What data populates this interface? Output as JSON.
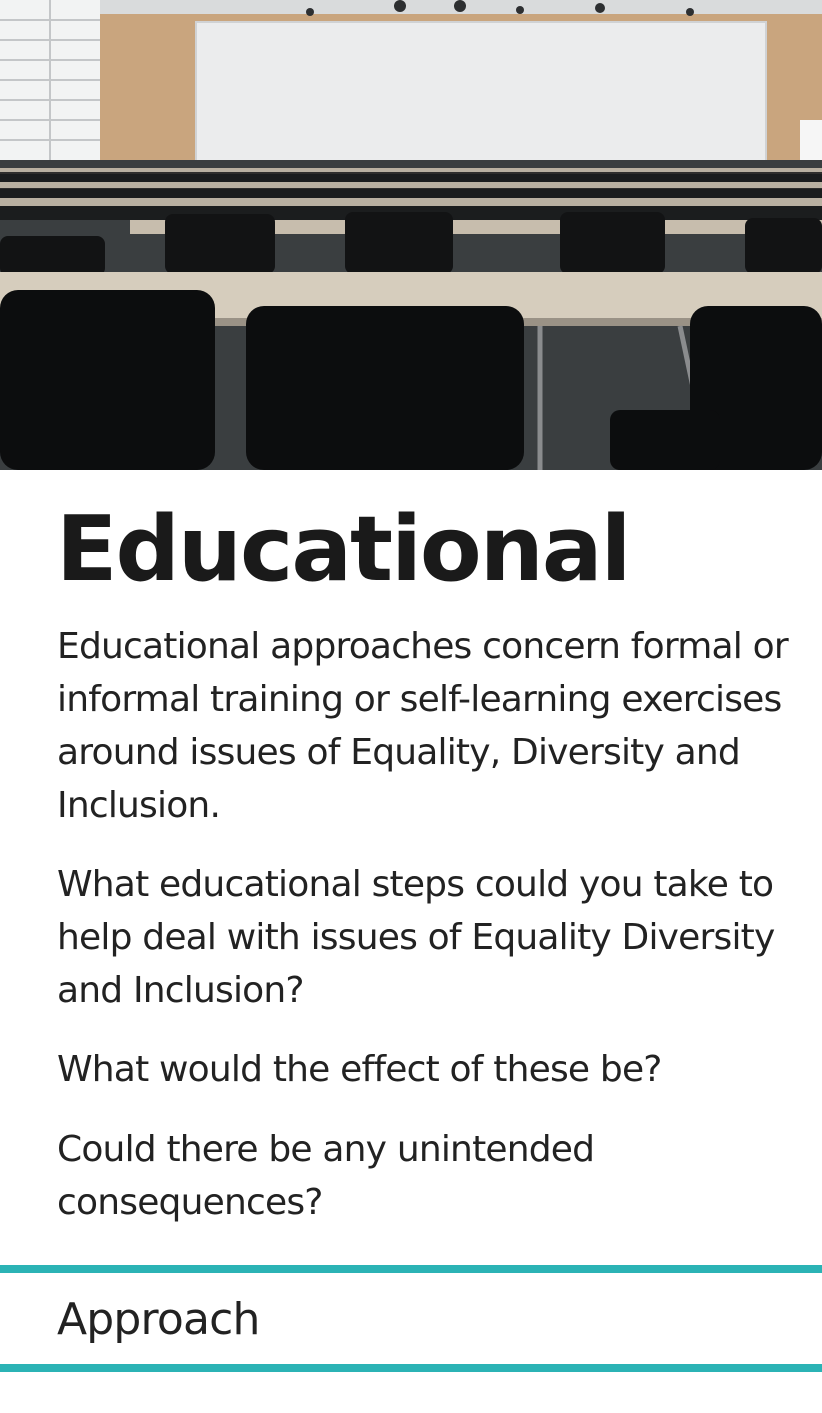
{
  "card": {
    "title": "Educational",
    "paragraphs": [
      "Educational approaches concern formal or informal training or self-learning exercises around issues of Equality, Diversity and Inclusion.",
      "What educational steps could you take to help deal with issues of Equality Diversity and Inclusion?",
      "What would the effect of these be?",
      "Could there be any unintended consequences?"
    ],
    "category": "Approach"
  },
  "colors": {
    "accent_rule": "#2bb3b5",
    "text": "#222222",
    "background": "#ffffff"
  },
  "image": {
    "subject": "lecture-hall-photo"
  }
}
